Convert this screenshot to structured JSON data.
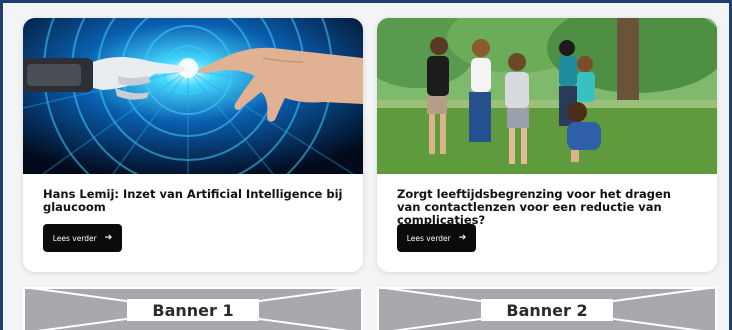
{
  "cards": [
    {
      "title": "Hans Lemij: Inzet van Artificial Intelligence bij glaucoom",
      "button_label": "Lees verder",
      "button_icon": "arrow-right-icon",
      "image": "robot-and-human-hand-touching-on-blue-tech-background"
    },
    {
      "title": "Zorgt leeftijdsbegrenzing voor het dragen van contactlenzen voor een reductie van complicaties?",
      "button_label": "Lees verder",
      "button_icon": "arrow-right-icon",
      "image": "children-playing-in-a-circle-in-a-park"
    }
  ],
  "banners": [
    {
      "label": "Banner 1"
    },
    {
      "label": "Banner 2"
    }
  ],
  "colors": {
    "frame_border": "#1f3f6e",
    "button_bg": "#0b0b0b",
    "banner_bg": "#a8a9ac"
  }
}
